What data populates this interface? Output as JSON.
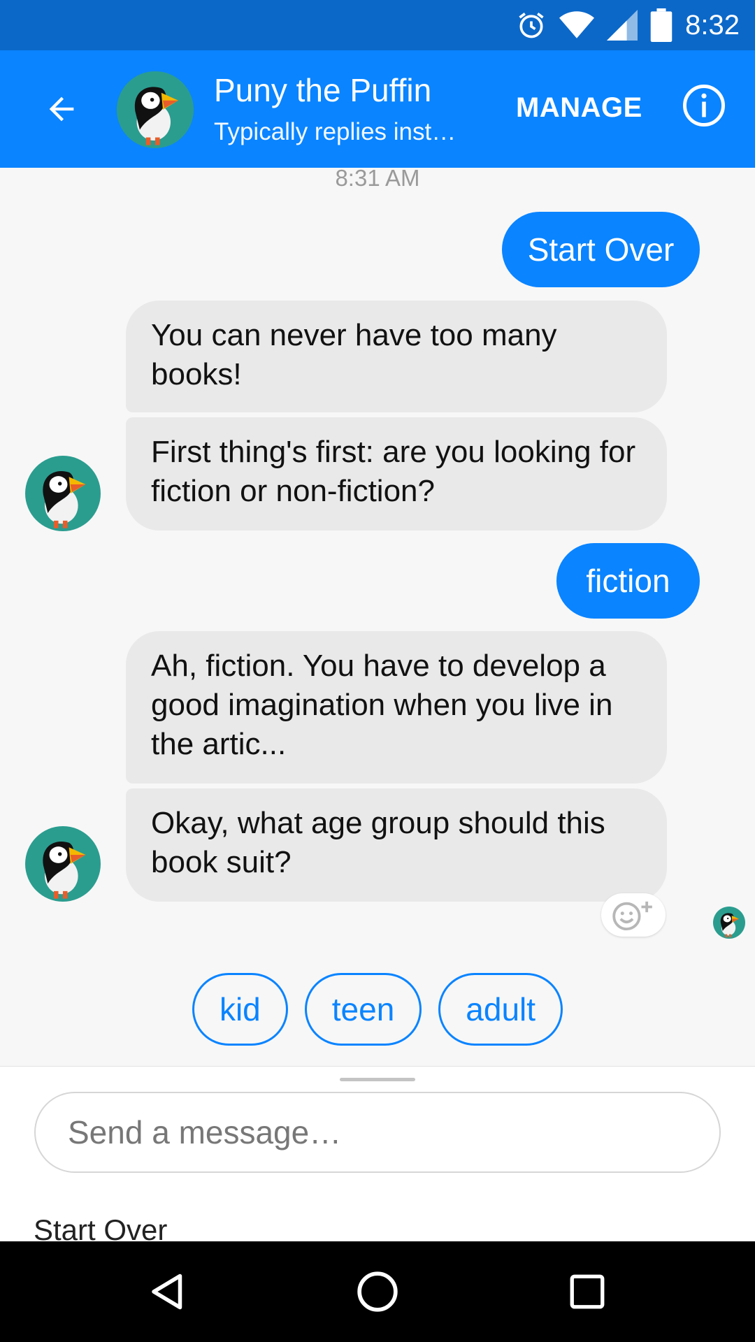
{
  "status_bar": {
    "time": "8:32"
  },
  "header": {
    "contact_name": "Puny the Puffin",
    "subtitle": "Typically replies inst…",
    "manage_label": "MANAGE"
  },
  "chat": {
    "timestamp": "8:31 AM",
    "messages": [
      {
        "from": "user",
        "text": "Start Over"
      },
      {
        "from": "bot",
        "text": "You can never have too many books!"
      },
      {
        "from": "bot",
        "text": "First thing's first: are you looking for fiction or non-fiction?"
      },
      {
        "from": "user",
        "text": "fiction"
      },
      {
        "from": "bot",
        "text": "Ah, fiction. You have to develop a good imagination when you live in the artic..."
      },
      {
        "from": "bot",
        "text": "Okay, what age group should this book suit?"
      }
    ]
  },
  "quick_replies": [
    "kid",
    "teen",
    "adult"
  ],
  "composer": {
    "placeholder": "Send a message…",
    "persistent_menu_label": "Start Over"
  },
  "colors": {
    "accent": "#0a84ff",
    "status_bar": "#0b68c9",
    "bot_bubble": "#e9e9e9",
    "avatar_bg": "#2a9d8f"
  }
}
